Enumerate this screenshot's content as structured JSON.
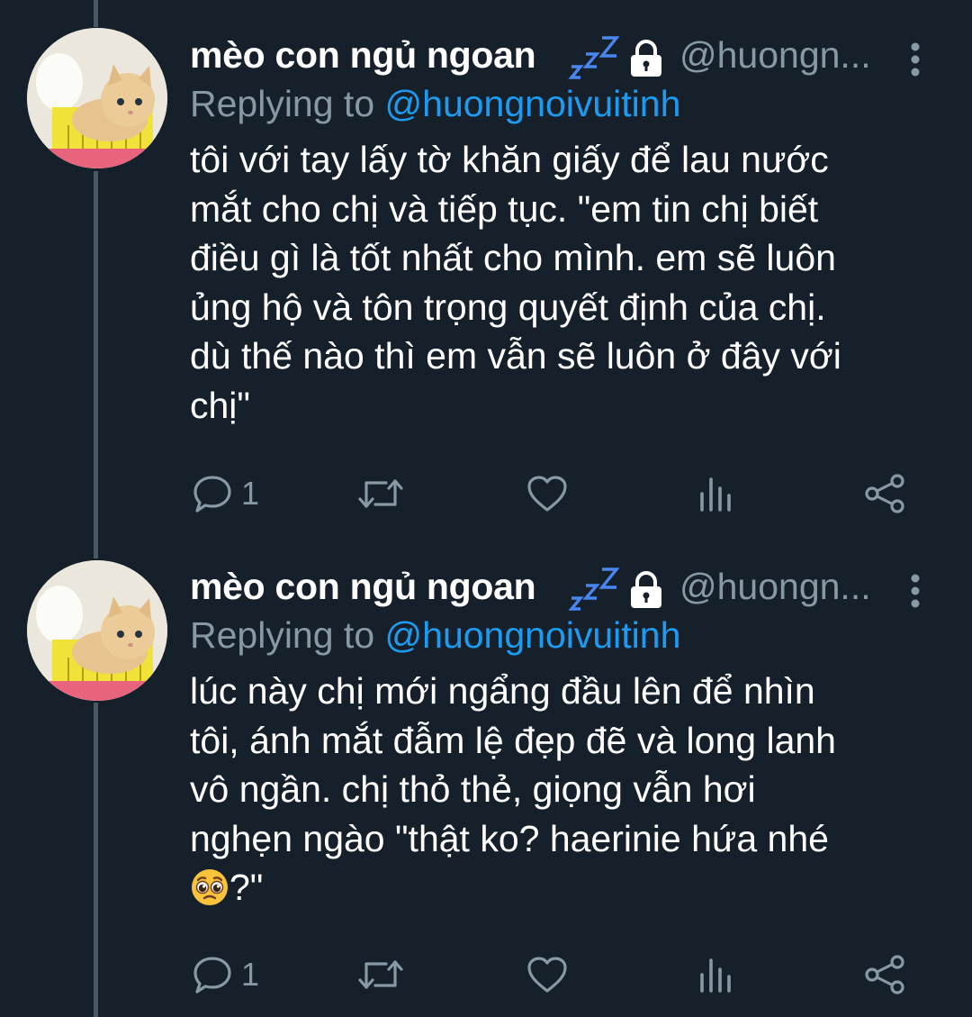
{
  "tweets": [
    {
      "display_name": "mèo con ngủ ngoan",
      "handle": "@huongn...",
      "replying_prefix": "Replying to ",
      "replying_to": "@huongnoivuitinh",
      "text_lines": [
        "tôi với tay lấy tờ khăn giấy để lau nước",
        "mắt cho chị và tiếp tục. \"em tin chị biết",
        "điều gì là tốt nhất cho mình. em sẽ luôn",
        "ủng hộ và tôn trọng quyết định của chị.",
        "dù thế nào thì em vẫn sẽ luôn ở đây với",
        "chị\""
      ],
      "reply_count": "1"
    },
    {
      "display_name": "mèo con ngủ ngoan",
      "handle": "@huongn...",
      "replying_prefix": "Replying to ",
      "replying_to": "@huongnoivuitinh",
      "text_lines": [
        "lúc này chị mới ngẩng đầu lên để nhìn",
        "tôi, ánh mắt đẫm lệ đẹp đẽ và long lanh",
        "vô ngần. chị thỏ thẻ, giọng vẫn hơi",
        "nghẹn ngào \"thật ko? haerinie hứa nhé"
      ],
      "last_line_text": "?\"",
      "reply_count": "1"
    }
  ],
  "icons": {
    "zzz": "zzz-icon",
    "lock": "lock-icon",
    "more": "more-vertical-icon",
    "reply": "comment-icon",
    "retweet": "retweet-icon",
    "like": "heart-icon",
    "analytics": "analytics-icon",
    "share": "share-icon",
    "emoji": "pleading-face-emoji"
  },
  "colors": {
    "background": "#15202b",
    "text": "#ffffff",
    "secondary": "#8899a6",
    "link": "#1d9bf0",
    "thread_line": "#4a5866"
  }
}
